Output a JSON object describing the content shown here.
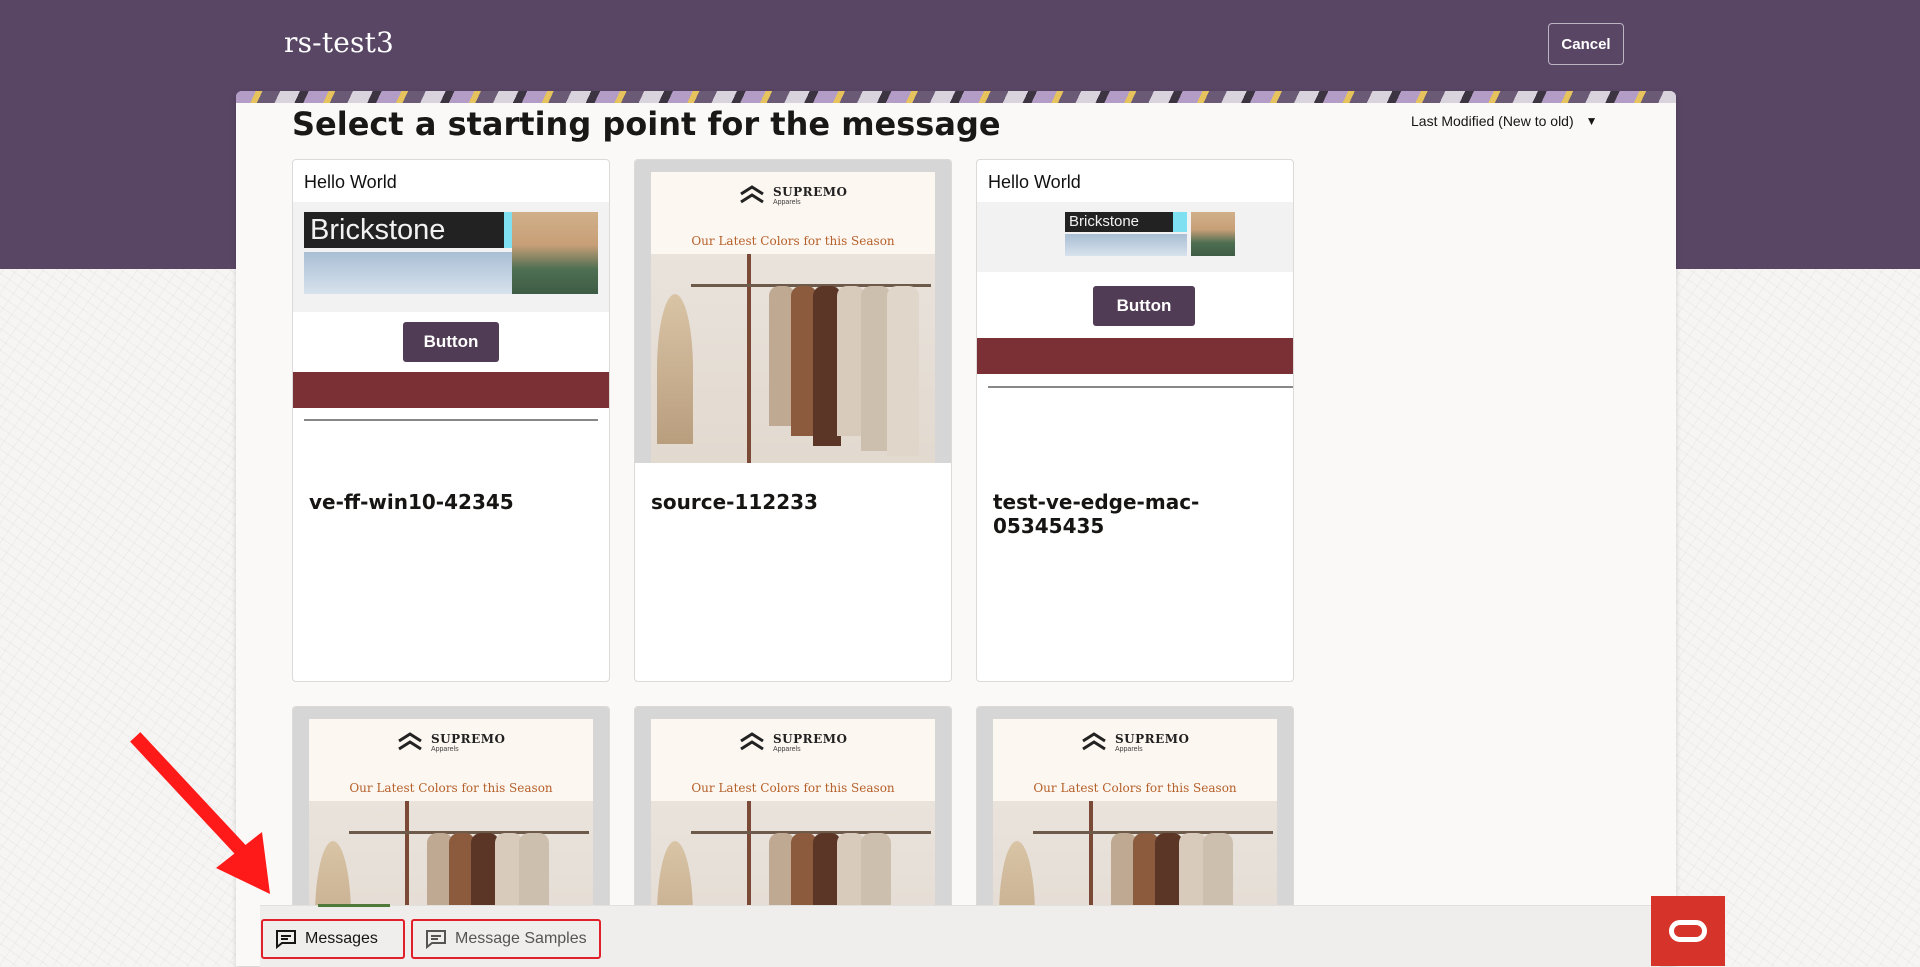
{
  "header": {
    "title": "rs-test3",
    "cancel_label": "Cancel"
  },
  "panel": {
    "heading": "Select a starting point for the message",
    "sort_label": "Last Modified (New to old)"
  },
  "templates": {
    "hello_world_title": "Hello World",
    "brickstone_logo": "Brickstone",
    "button_text": "Button",
    "supremo_brand": "SUPREMO",
    "supremo_sub": "Apparels",
    "supremo_tagline": "Our Latest Colors for this Season"
  },
  "cards": [
    {
      "name": "ve-ff-win10-42345",
      "template": "hello-world"
    },
    {
      "name": "source-112233",
      "template": "supremo"
    },
    {
      "name": "test-ve-edge-mac-05345435",
      "template": "hello-world"
    },
    {
      "name": "",
      "template": "supremo"
    },
    {
      "name": "",
      "template": "supremo"
    },
    {
      "name": "",
      "template": "supremo"
    }
  ],
  "bottom_bar": {
    "messages_label": "Messages",
    "samples_label": "Message Samples"
  },
  "colors": {
    "header_band": "#594665",
    "button": "#503c55",
    "red_band": "#7a3034",
    "highlight": "#e0202a",
    "oracle_red": "#d6332a"
  }
}
